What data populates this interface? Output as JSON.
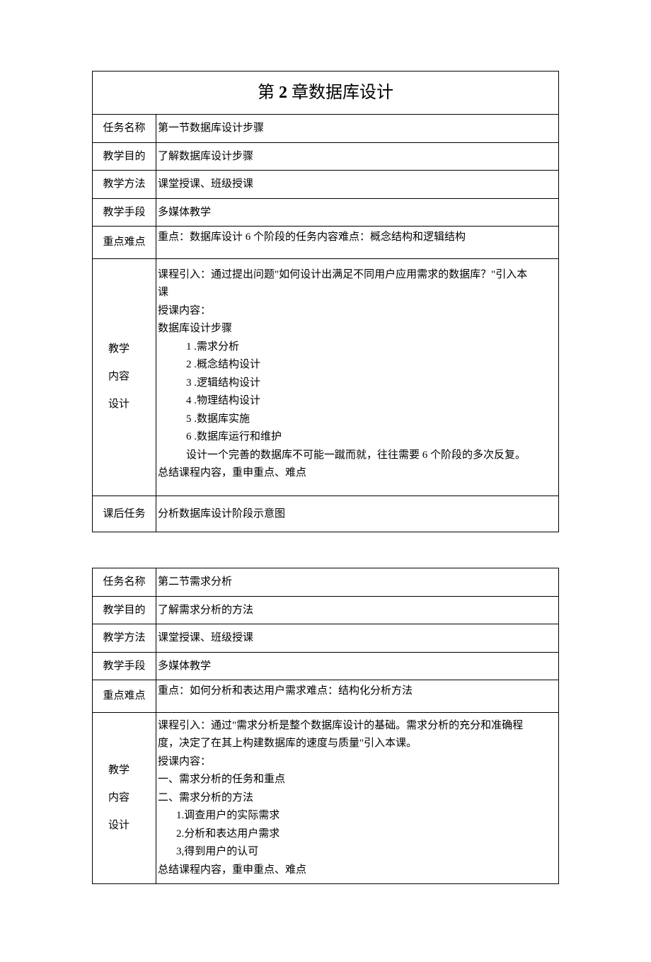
{
  "table1": {
    "title_prefix": "第",
    "title_number": "2",
    "title_suffix": "章数据库设计",
    "rows": {
      "task_name_label": "任务名称",
      "task_name_value": "第一节数据库设计步骤",
      "objective_label": "教学目的",
      "objective_value": "了解数据库设计步骤",
      "method_label": "教学方法",
      "method_value": "课堂授课、班级授课",
      "means_label": "教学手段",
      "means_value": "多媒体教学",
      "difficulty_label": "重点难点",
      "difficulty_value": "重点：数据库设计 6 个阶段的任务内容难点：概念结构和逻辑结构",
      "design_label_1": "教学",
      "design_label_2": "内容",
      "design_label_3": "设计",
      "intro_line1": "课程引入：通过提出问题\"如何设计出满足不同用户应用需求的数据库？\"引入本",
      "intro_line2": "课",
      "content_heading": "授课内容：",
      "steps_heading": "数据库设计步骤",
      "step1": "1 .需求分析",
      "step2": "2 .概念结构设计",
      "step3": "3 .逻辑结构设计",
      "step4": "4 .物理结构设计",
      "step5": "5 .数据库实施",
      "step6": "6 .数据库运行和维护",
      "note": "设计一个完善的数据库不可能一蹴而就，往往需要 6 个阶段的多次反复。",
      "summary": "总结课程内容，重申重点、难点",
      "after_label": "课后任务",
      "after_value": "分析数据库设计阶段示意图"
    }
  },
  "table2": {
    "rows": {
      "task_name_label": "任务名称",
      "task_name_value": "第二节需求分析",
      "objective_label": "教学目的",
      "objective_value": "了解需求分析的方法",
      "method_label": "教学方法",
      "method_value": "课堂授课、班级授课",
      "means_label": "教学手段",
      "means_value": "多媒体教学",
      "difficulty_label": "重点难点",
      "difficulty_value": "重点：如何分析和表达用户需求难点：结构化分析方法",
      "design_label_1": "教学",
      "design_label_2": "内容",
      "design_label_3": "设计",
      "intro_line1": "课程引入：通过\"需求分析是整个数据库设计的基础。需求分析的充分和准确程",
      "intro_line2": "度，决定了在其上构建数据库的速度与质量\"引入本课。",
      "content_heading": "授课内容：",
      "sec1": "一、需求分析的任务和重点",
      "sec2": "二、需求分析的方法",
      "m1": "1.调查用户的实际需求",
      "m2": "2.分析和表达用户需求",
      "m3": "3,得到用户的认可",
      "summary": "总结课程内容，重申重点、难点"
    }
  }
}
